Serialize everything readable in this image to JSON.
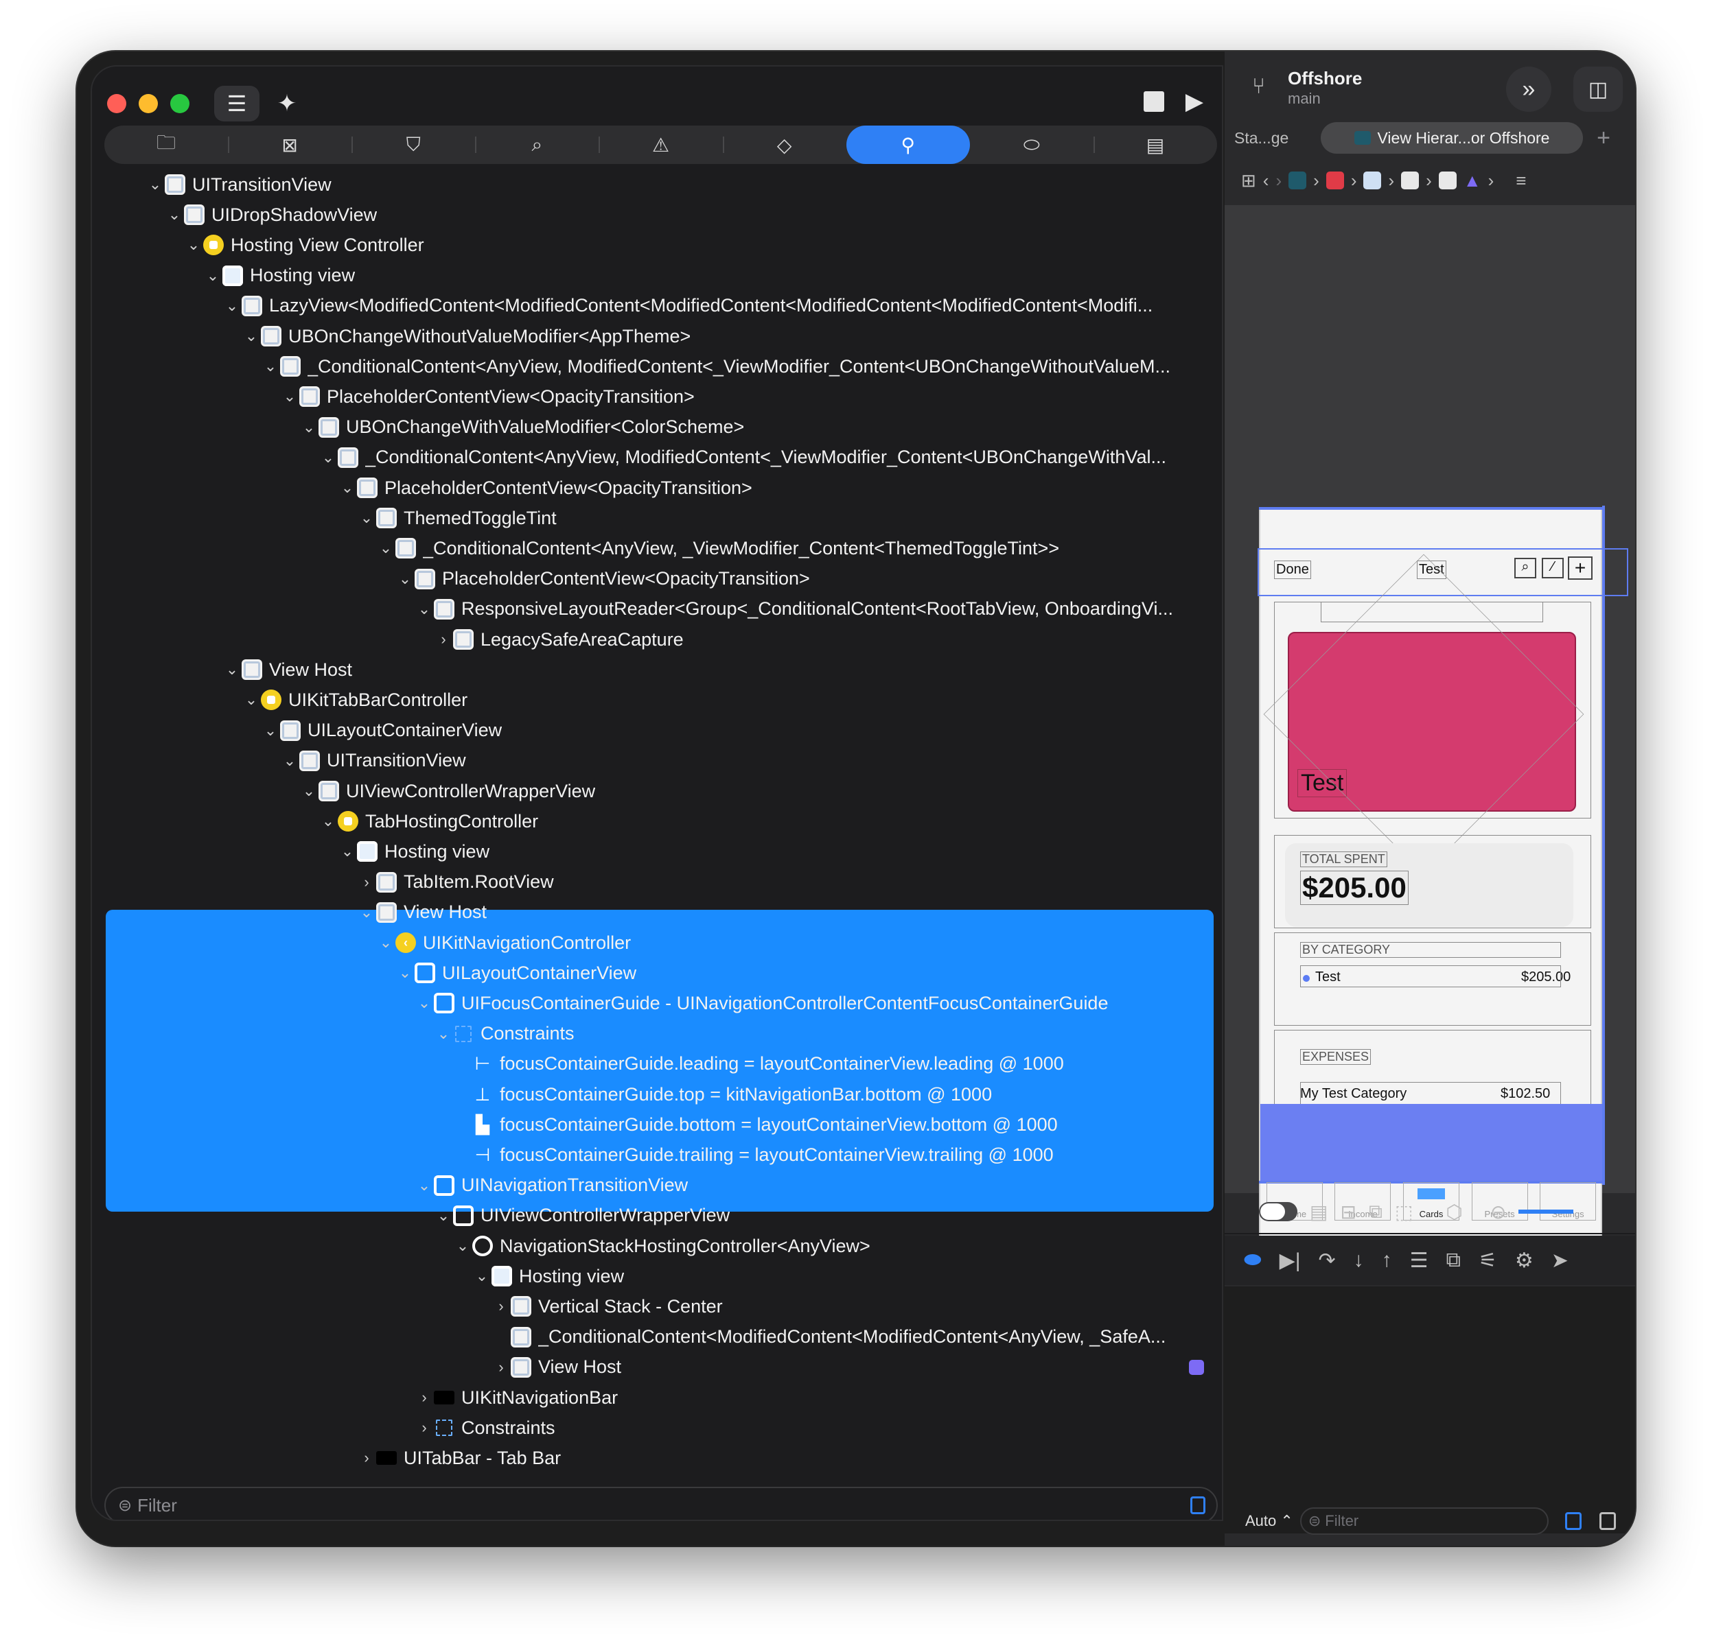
{
  "toolbar": {
    "project_name": "Offshore",
    "branch": "main"
  },
  "navigator_tabs": [
    "project-navigator",
    "source-control",
    "bookmarks",
    "find",
    "issues",
    "tests",
    "debug",
    "breakpoints",
    "reports"
  ],
  "tree": [
    {
      "depth": 0,
      "chev": "open",
      "icon": "view",
      "label": "UITransitionView"
    },
    {
      "depth": 1,
      "chev": "open",
      "icon": "view",
      "label": "UIDropShadowView"
    },
    {
      "depth": 2,
      "chev": "open",
      "icon": "vc",
      "label": "Hosting View Controller"
    },
    {
      "depth": 3,
      "chev": "open",
      "icon": "host",
      "label": "Hosting view"
    },
    {
      "depth": 4,
      "chev": "open",
      "icon": "view",
      "label": "LazyView<ModifiedContent<ModifiedContent<ModifiedContent<ModifiedContent<ModifiedContent<Modifi..."
    },
    {
      "depth": 5,
      "chev": "open",
      "icon": "view",
      "label": "UBOnChangeWithoutValueModifier<AppTheme>"
    },
    {
      "depth": 6,
      "chev": "open",
      "icon": "view",
      "label": "_ConditionalContent<AnyView, ModifiedContent<_ViewModifier_Content<UBOnChangeWithoutValueM..."
    },
    {
      "depth": 7,
      "chev": "open",
      "icon": "view",
      "label": "PlaceholderContentView<OpacityTransition>"
    },
    {
      "depth": 8,
      "chev": "open",
      "icon": "view",
      "label": "UBOnChangeWithValueModifier<ColorScheme>"
    },
    {
      "depth": 9,
      "chev": "open",
      "icon": "view",
      "label": "_ConditionalContent<AnyView, ModifiedContent<_ViewModifier_Content<UBOnChangeWithVal..."
    },
    {
      "depth": 10,
      "chev": "open",
      "icon": "view",
      "label": "PlaceholderContentView<OpacityTransition>"
    },
    {
      "depth": 11,
      "chev": "open",
      "icon": "view",
      "label": "ThemedToggleTint"
    },
    {
      "depth": 12,
      "chev": "open",
      "icon": "view",
      "label": "_ConditionalContent<AnyView, _ViewModifier_Content<ThemedToggleTint>>"
    },
    {
      "depth": 13,
      "chev": "open",
      "icon": "view",
      "label": "PlaceholderContentView<OpacityTransition>"
    },
    {
      "depth": 14,
      "chev": "open",
      "icon": "view",
      "label": "ResponsiveLayoutReader<Group<_ConditionalContent<RootTabView, OnboardingVi..."
    },
    {
      "depth": 15,
      "chev": "closed",
      "icon": "view",
      "label": "LegacySafeAreaCapture"
    },
    {
      "depth": 4,
      "chev": "open",
      "icon": "view",
      "label": "View Host"
    },
    {
      "depth": 5,
      "chev": "open",
      "icon": "vc",
      "label": "UIKitTabBarController"
    },
    {
      "depth": 6,
      "chev": "open",
      "icon": "view",
      "label": "UILayoutContainerView"
    },
    {
      "depth": 7,
      "chev": "open",
      "icon": "view",
      "label": "UITransitionView"
    },
    {
      "depth": 8,
      "chev": "open",
      "icon": "view",
      "label": "UIViewControllerWrapperView"
    },
    {
      "depth": 9,
      "chev": "open",
      "icon": "vc",
      "label": "TabHostingController"
    },
    {
      "depth": 10,
      "chev": "open",
      "icon": "host",
      "label": "Hosting view"
    },
    {
      "depth": 11,
      "chev": "closed",
      "icon": "view",
      "label": "TabItem.RootView"
    },
    {
      "depth": 11,
      "chev": "open",
      "icon": "view",
      "label": "View Host"
    },
    {
      "depth": 12,
      "chev": "open",
      "icon": "navvc",
      "label": "UIKitNavigationController"
    },
    {
      "depth": 13,
      "chev": "open",
      "icon": "white-outline",
      "label": "UILayoutContainerView"
    },
    {
      "depth": 14,
      "chev": "open",
      "icon": "white-outline",
      "label": "UIFocusContainerGuide - UINavigationControllerContentFocusContainerGuide"
    },
    {
      "depth": 15,
      "chev": "open",
      "icon": "constraint",
      "label": "Constraints"
    },
    {
      "depth": 16,
      "chev": "none",
      "icon": "cons-item",
      "glyph": "⊢",
      "label": "focusContainerGuide.leading = layoutContainerView.leading @ 1000"
    },
    {
      "depth": 16,
      "chev": "none",
      "icon": "cons-item",
      "glyph": "⊥",
      "label": "focusContainerGuide.top = kitNavigationBar.bottom @ 1000"
    },
    {
      "depth": 16,
      "chev": "none",
      "icon": "cons-item",
      "glyph": "▙",
      "label": "focusContainerGuide.bottom = layoutContainerView.bottom @ 1000"
    },
    {
      "depth": 16,
      "chev": "none",
      "icon": "cons-item",
      "glyph": "⊣",
      "label": "focusContainerGuide.trailing = layoutContainerView.trailing @ 1000"
    },
    {
      "depth": 14,
      "chev": "open",
      "icon": "white-outline",
      "label": "UINavigationTransitionView"
    },
    {
      "depth": 15,
      "chev": "open",
      "icon": "white-outline",
      "label": "UIViewControllerWrapperView"
    },
    {
      "depth": 16,
      "chev": "open",
      "icon": "circle-outline",
      "label": "NavigationStackHostingController<AnyView>"
    },
    {
      "depth": 17,
      "chev": "open",
      "icon": "host",
      "label": "Hosting view"
    },
    {
      "depth": 18,
      "chev": "closed",
      "icon": "view",
      "label": "Vertical Stack - Center"
    },
    {
      "depth": 18,
      "chev": "none",
      "icon": "view",
      "label": "_ConditionalContent<ModifiedContent<ModifiedContent<AnyView, _SafeA..."
    },
    {
      "depth": 18,
      "chev": "closed",
      "icon": "view",
      "label": "View Host"
    },
    {
      "depth": 14,
      "chev": "closed",
      "icon": "bar",
      "label": "UIKitNavigationBar"
    },
    {
      "depth": 14,
      "chev": "closed",
      "icon": "constraint",
      "label": "Constraints"
    },
    {
      "depth": 11,
      "chev": "closed",
      "icon": "bar",
      "label": "UITabBar - Tab Bar"
    }
  ],
  "filter": {
    "placeholder": "Filter"
  },
  "editor_tabs": {
    "previous": "Sta...ge",
    "active": "View Hierar...or Offshore"
  },
  "preview": {
    "nav_done": "Done",
    "nav_title": "Test",
    "card_title": "Test",
    "total_spent_label": "TOTAL SPENT",
    "total_spent_value": "$205.00",
    "by_category_label": "BY CATEGORY",
    "category_name": "Test",
    "category_value": "$205.00",
    "expenses_label": "EXPENSES",
    "expense_name": "My Test Category",
    "expense_value": "$102.50",
    "tabs": [
      "Home",
      "Income",
      "Cards",
      "Presets",
      "Settings"
    ],
    "card_color": "#d43b6e",
    "selection_color": "#5e7cf0"
  },
  "right_filter": {
    "mode": "Auto",
    "placeholder": "Filter"
  },
  "colors": {
    "selection": "#1a8cff",
    "accent": "#2f80f5"
  }
}
